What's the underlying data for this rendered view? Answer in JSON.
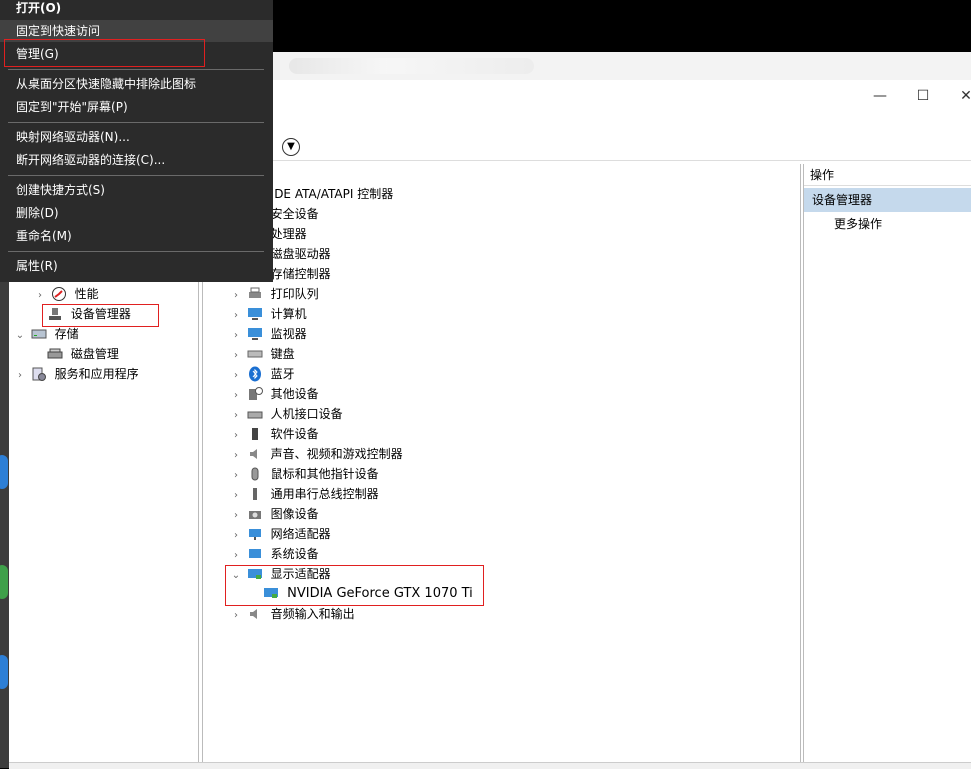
{
  "context_menu": {
    "items": [
      {
        "label": "打开(O)",
        "bold": true
      },
      {
        "label": "固定到快速访问"
      },
      {
        "label": "管理(G)"
      },
      {
        "label": "从桌面分区快速隐藏中排除此图标"
      },
      {
        "label": "固定到\"开始\"屏幕(P)"
      },
      {
        "label": "映射网络驱动器(N)..."
      },
      {
        "label": "断开网络驱动器的连接(C)..."
      },
      {
        "label": "创建快捷方式(S)"
      },
      {
        "label": "删除(D)"
      },
      {
        "label": "重命名(M)"
      },
      {
        "label": "属性(R)"
      }
    ]
  },
  "window": {
    "controls": {
      "minimize": "—",
      "maximize": "☐",
      "close": "✕"
    }
  },
  "left_tree": {
    "items": [
      {
        "label": "性能",
        "icon": "performance-icon"
      },
      {
        "label": "设备管理器",
        "icon": "device-manager-icon"
      },
      {
        "label": "存储",
        "icon": "storage-icon"
      },
      {
        "label": "磁盘管理",
        "icon": "disk-management-icon"
      },
      {
        "label": "服务和应用程序",
        "icon": "services-icon"
      }
    ]
  },
  "device_tree": {
    "items": [
      {
        "label": "IDE ATA/ATAPI 控制器"
      },
      {
        "label": "安全设备"
      },
      {
        "label": "处理器"
      },
      {
        "label": "磁盘驱动器"
      },
      {
        "label": "存储控制器"
      },
      {
        "label": "打印队列"
      },
      {
        "label": "计算机"
      },
      {
        "label": "监视器"
      },
      {
        "label": "键盘"
      },
      {
        "label": "蓝牙"
      },
      {
        "label": "其他设备"
      },
      {
        "label": "人机接口设备"
      },
      {
        "label": "软件设备"
      },
      {
        "label": "声音、视频和游戏控制器"
      },
      {
        "label": "鼠标和其他指针设备"
      },
      {
        "label": "通用串行总线控制器"
      },
      {
        "label": "图像设备"
      },
      {
        "label": "网络适配器"
      },
      {
        "label": "系统设备"
      },
      {
        "label": "显示适配器"
      },
      {
        "label": "NVIDIA GeForce GTX 1070 Ti"
      },
      {
        "label": "音频输入和输出"
      }
    ]
  },
  "actions_pane": {
    "header": "操作",
    "section": "设备管理器",
    "more": "更多操作"
  },
  "colors": {
    "menu_bg": "#2b2b2b",
    "menu_hover": "#414141",
    "highlight": "#e02020",
    "actions_selected": "#c5d9ec"
  }
}
